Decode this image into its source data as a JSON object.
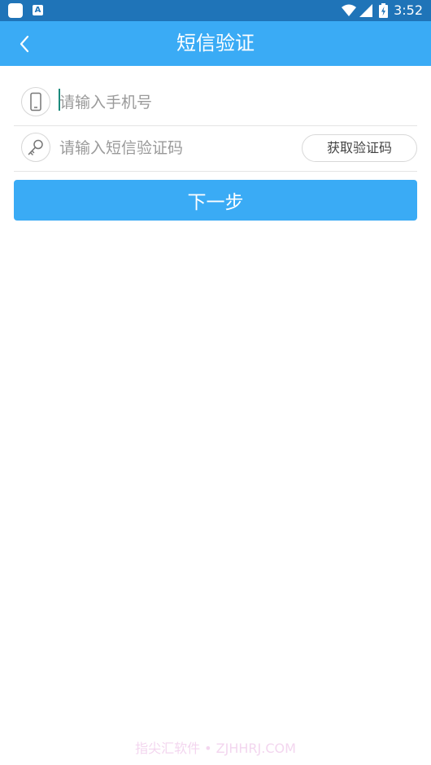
{
  "status_bar": {
    "time": "3:52",
    "notification_icon_letter": "A",
    "icons": [
      "app-icon",
      "notification-icon",
      "wifi-icon",
      "signal-icon",
      "battery-icon"
    ]
  },
  "app_bar": {
    "title": "短信验证",
    "back_icon": "chevron-left-icon",
    "background": "#3aabf5"
  },
  "form": {
    "phone": {
      "placeholder": "请输入手机号",
      "value": "",
      "icon": "phone-icon"
    },
    "code": {
      "placeholder": "请输入短信验证码",
      "value": "",
      "icon": "key-icon",
      "get_code_label": "获取验证码"
    },
    "next_label": "下一步"
  },
  "watermark": "指尖汇软件 • ZJHHRJ.COM",
  "colors": {
    "status_bar": "#1f74b8",
    "accent": "#3aabf5",
    "caret": "#1a8a7c",
    "watermark": "#f3d6ef"
  }
}
